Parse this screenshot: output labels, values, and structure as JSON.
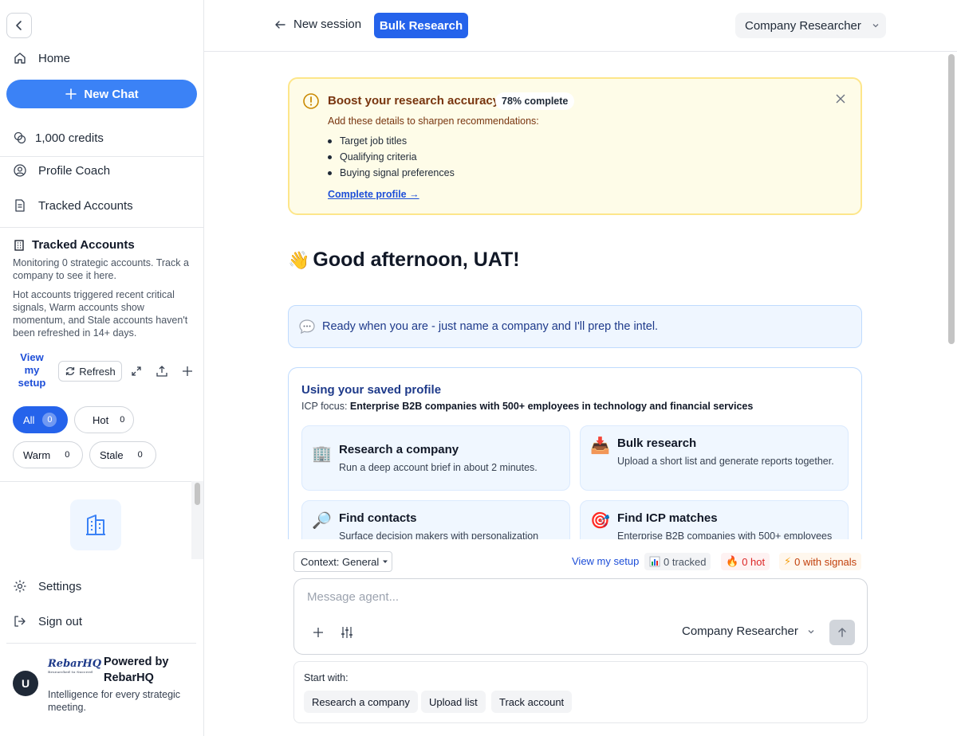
{
  "sidebar": {
    "home_label": "Home",
    "new_chat_label": "New Chat",
    "credits_label": "1,000 credits",
    "profile_coach_label": "Profile Coach",
    "tracked_accounts_nav_label": "Tracked Accounts",
    "tracked": {
      "title": "Tracked Accounts",
      "desc1": "Monitoring 0 strategic accounts. Track a company to see it here.",
      "desc2": "Hot accounts triggered recent critical signals, Warm accounts show momentum, and Stale accounts haven't been refreshed in 14+ days.",
      "view_setup_label": "View my setup",
      "refresh_label": "Refresh",
      "filters": [
        {
          "label": "All",
          "count": "0"
        },
        {
          "label": "Hot",
          "count": "0"
        },
        {
          "label": "Warm",
          "count": "0"
        },
        {
          "label": "Stale",
          "count": "0"
        }
      ]
    },
    "settings_label": "Settings",
    "signout_label": "Sign out",
    "footer": {
      "avatar_initial": "U",
      "logo_text": "RebarHQ",
      "logo_sub": "Researched to Succeed",
      "powered_title": "Powered by RebarHQ",
      "tagline": "Intelligence for every strategic meeting."
    }
  },
  "header": {
    "new_session_label": "New session",
    "bulk_research_label": "Bulk Research",
    "agent_label": "Company Researcher"
  },
  "banner": {
    "title": "Boost your research accuracy",
    "badge": "78% complete",
    "subtitle": "Add these details to sharpen recommendations:",
    "items": [
      "Target job titles",
      "Qualifying criteria",
      "Buying signal preferences"
    ],
    "link": "Complete profile →"
  },
  "greeting": {
    "emoji": "👋",
    "text": "Good afternoon, UAT!"
  },
  "ready_message": "Ready when you are - just name a company and I'll prep the intel.",
  "profile_card": {
    "title": "Using your saved profile",
    "icp_label": "ICP focus:",
    "icp_value": "Enterprise B2B companies with 500+ employees in technology and financial services",
    "actions": [
      {
        "icon": "🏢",
        "title": "Research a company",
        "desc": "Run a deep account brief in about 2 minutes."
      },
      {
        "icon": "📥",
        "title": "Bulk research",
        "desc": "Upload a short list and generate reports together."
      },
      {
        "icon": "🔎",
        "title": "Find contacts",
        "desc": "Surface decision makers with personalization"
      },
      {
        "icon": "🎯",
        "title": "Find ICP matches",
        "desc": "Enterprise B2B companies with 500+ employees"
      }
    ]
  },
  "composer": {
    "context_label": "Context: General",
    "view_setup_label": "View my setup",
    "stats": {
      "tracked": "0 tracked",
      "hot": "0 hot",
      "signals": "0 with signals"
    },
    "placeholder": "Message agent...",
    "agent_label": "Company Researcher",
    "start_label": "Start with:",
    "start_chips": [
      "Research a company",
      "Upload list",
      "Track account"
    ]
  }
}
